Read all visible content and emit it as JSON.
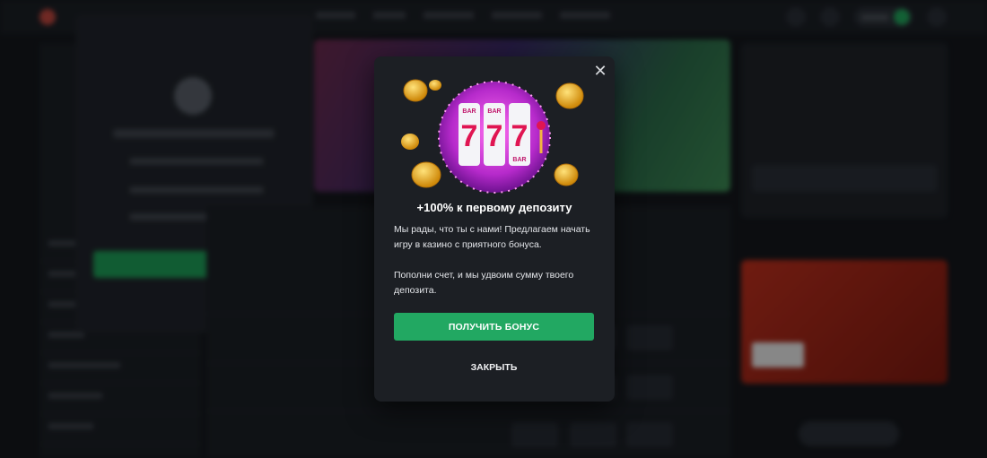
{
  "modal": {
    "title": "+100% к первому депозиту",
    "text1": "Мы рады, что ты с нами! Предлагаем начать игру в казино с приятного бонуса.",
    "text2": "Пополни счет, и мы удвоим сумму твоего депозита.",
    "primary_label": "ПОЛУЧИТЬ БОНУС",
    "secondary_label": "ЗАКРЫТЬ",
    "close_symbol": "✕",
    "slot_symbol": "7",
    "bar_symbol": "BAR",
    "accent_color": "#22a862"
  },
  "icons": {
    "close": "close-icon",
    "hero": "slot-machine-illustration"
  }
}
